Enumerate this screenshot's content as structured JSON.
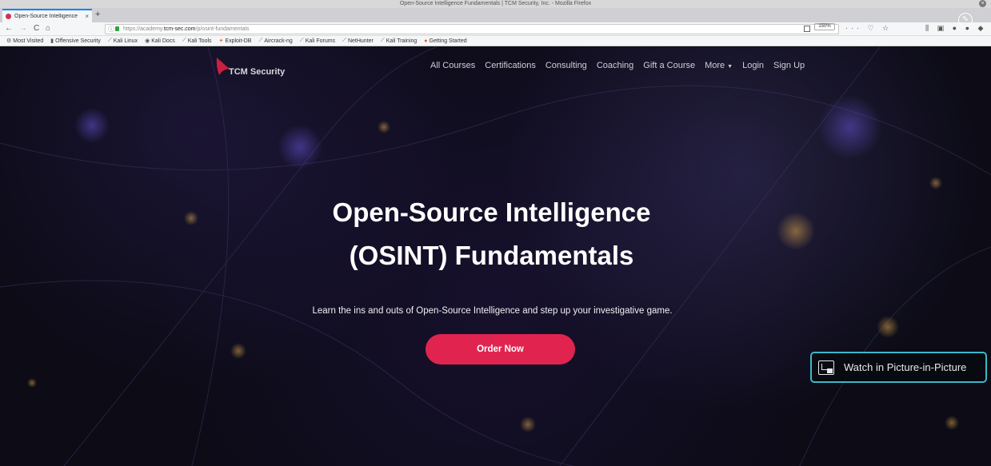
{
  "window": {
    "title": "Open-Source Intelligence Fundamentals | TCM Security, Inc. - Mozilla Firefox",
    "close": "×"
  },
  "tabs": [
    {
      "label": "Open-Source Intelligence",
      "close": "×"
    }
  ],
  "new_tab": "+",
  "nav": {
    "back": "←",
    "forward": "→",
    "reload": "C",
    "home": "⌂"
  },
  "url": {
    "info": "ⓘ",
    "prefix": "https://academy.",
    "domain": "tcm-sec.com",
    "path": "/p/osint-fundamentals"
  },
  "zoom": "150%",
  "url_actions": "··· ♡ ☆",
  "toolbar_icons": "⫼ ▣ ● ● ◆",
  "bookmarks": [
    {
      "icon": "gear-icon",
      "glyph": "⚙",
      "label": "Most Visited"
    },
    {
      "icon": "offsec-icon",
      "glyph": "▮",
      "label": "Offensive Security"
    },
    {
      "icon": "kali-icon",
      "glyph": "⟋",
      "label": "Kali Linux"
    },
    {
      "icon": "kali-docs-icon",
      "glyph": "◉",
      "label": "Kali Docs"
    },
    {
      "icon": "kali-icon",
      "glyph": "⟋",
      "label": "Kali Tools"
    },
    {
      "icon": "exploit-db-icon",
      "glyph": "✦",
      "label": "Exploit-DB"
    },
    {
      "icon": "aircrack-icon",
      "glyph": "⟋",
      "label": "Aircrack-ng"
    },
    {
      "icon": "kali-icon",
      "glyph": "⟋",
      "label": "Kali Forums"
    },
    {
      "icon": "kali-icon",
      "glyph": "⟋",
      "label": "NetHunter"
    },
    {
      "icon": "kali-icon",
      "glyph": "⟋",
      "label": "Kali Training"
    },
    {
      "icon": "firefox-icon",
      "glyph": "●",
      "label": "Getting Started"
    }
  ],
  "site": {
    "logo_text": "TCM Security",
    "nav": [
      {
        "label": "All Courses"
      },
      {
        "label": "Certifications"
      },
      {
        "label": "Consulting"
      },
      {
        "label": "Coaching"
      },
      {
        "label": "Gift a Course"
      },
      {
        "label": "More",
        "caret": "▼"
      },
      {
        "label": "Login"
      },
      {
        "label": "Sign Up"
      }
    ],
    "hero": {
      "title_line1": "Open-Source Intelligence",
      "title_line2": "(OSINT) Fundamentals",
      "subtitle": "Learn the ins and outs of Open-Source Intelligence and step up your investigative game.",
      "cta": "Order Now"
    }
  },
  "pip": {
    "label": "Watch in Picture-in-Picture"
  },
  "overlay_icon": "✎",
  "colors": {
    "accent": "#e0244f",
    "pip_border": "#3ab8c8",
    "tab_accent": "#0a84ff"
  }
}
